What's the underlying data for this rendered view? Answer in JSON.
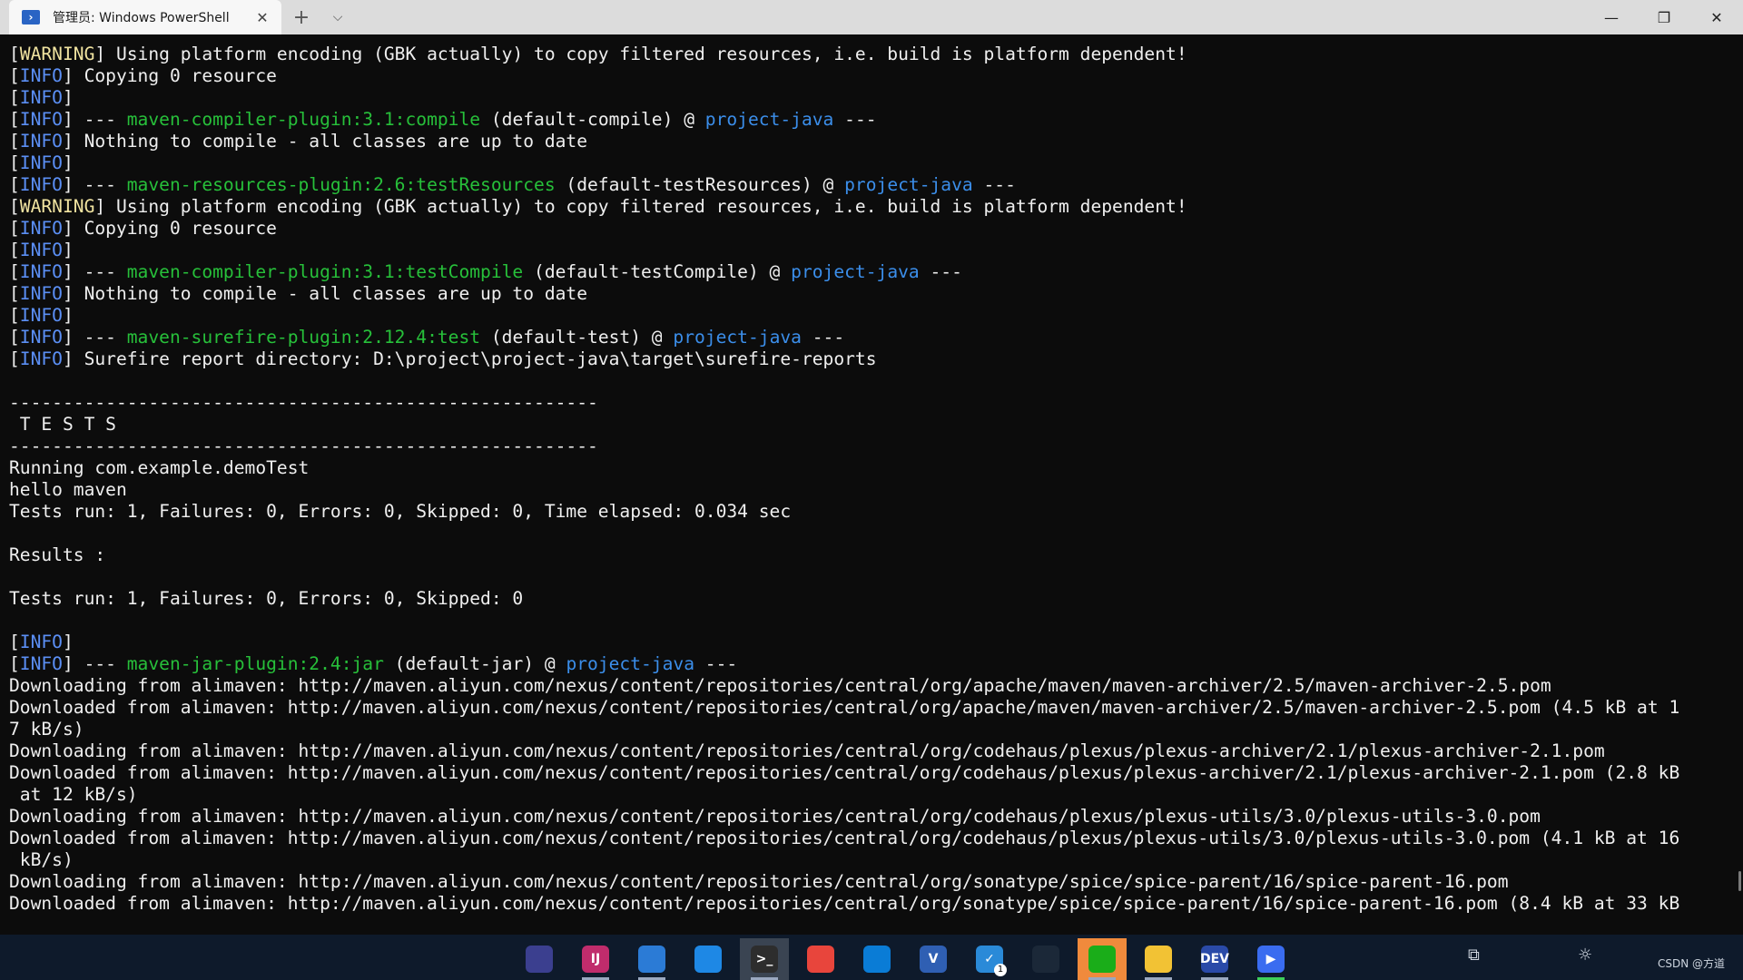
{
  "window": {
    "tab_title": "管理员: Windows PowerShell",
    "tab_icon": "powershell-icon",
    "new_tab": "+",
    "dropdown": "⌵",
    "minimize": "—",
    "restore": "❐",
    "close": "✕"
  },
  "colors": {
    "background": "#0c0c0c",
    "warning": "#f0e3a0",
    "info": "#5b8ff5",
    "plugin": "#27c03a",
    "project": "#3b8eea"
  },
  "terminal": {
    "lines": [
      [
        {
          "t": "[",
          "c": "w"
        },
        {
          "t": "WARNING",
          "c": "y"
        },
        {
          "t": "] Using platform encoding (GBK actually) to copy filtered resources, i.e. build is platform dependent!",
          "c": "w"
        }
      ],
      [
        {
          "t": "[",
          "c": "w"
        },
        {
          "t": "INFO",
          "c": "b"
        },
        {
          "t": "] Copying 0 resource",
          "c": "w"
        }
      ],
      [
        {
          "t": "[",
          "c": "w"
        },
        {
          "t": "INFO",
          "c": "b"
        },
        {
          "t": "]",
          "c": "w"
        }
      ],
      [
        {
          "t": "[",
          "c": "w"
        },
        {
          "t": "INFO",
          "c": "b"
        },
        {
          "t": "] --- ",
          "c": "w"
        },
        {
          "t": "maven-compiler-plugin:3.1:compile",
          "c": "g"
        },
        {
          "t": " (default-compile) @ ",
          "c": "w"
        },
        {
          "t": "project-java",
          "c": "p"
        },
        {
          "t": " ---",
          "c": "w"
        }
      ],
      [
        {
          "t": "[",
          "c": "w"
        },
        {
          "t": "INFO",
          "c": "b"
        },
        {
          "t": "] Nothing to compile - all classes are up to date",
          "c": "w"
        }
      ],
      [
        {
          "t": "[",
          "c": "w"
        },
        {
          "t": "INFO",
          "c": "b"
        },
        {
          "t": "]",
          "c": "w"
        }
      ],
      [
        {
          "t": "[",
          "c": "w"
        },
        {
          "t": "INFO",
          "c": "b"
        },
        {
          "t": "] --- ",
          "c": "w"
        },
        {
          "t": "maven-resources-plugin:2.6:testResources",
          "c": "g"
        },
        {
          "t": " (default-testResources) @ ",
          "c": "w"
        },
        {
          "t": "project-java",
          "c": "p"
        },
        {
          "t": " ---",
          "c": "w"
        }
      ],
      [
        {
          "t": "[",
          "c": "w"
        },
        {
          "t": "WARNING",
          "c": "y"
        },
        {
          "t": "] Using platform encoding (GBK actually) to copy filtered resources, i.e. build is platform dependent!",
          "c": "w"
        }
      ],
      [
        {
          "t": "[",
          "c": "w"
        },
        {
          "t": "INFO",
          "c": "b"
        },
        {
          "t": "] Copying 0 resource",
          "c": "w"
        }
      ],
      [
        {
          "t": "[",
          "c": "w"
        },
        {
          "t": "INFO",
          "c": "b"
        },
        {
          "t": "]",
          "c": "w"
        }
      ],
      [
        {
          "t": "[",
          "c": "w"
        },
        {
          "t": "INFO",
          "c": "b"
        },
        {
          "t": "] --- ",
          "c": "w"
        },
        {
          "t": "maven-compiler-plugin:3.1:testCompile",
          "c": "g"
        },
        {
          "t": " (default-testCompile) @ ",
          "c": "w"
        },
        {
          "t": "project-java",
          "c": "p"
        },
        {
          "t": " ---",
          "c": "w"
        }
      ],
      [
        {
          "t": "[",
          "c": "w"
        },
        {
          "t": "INFO",
          "c": "b"
        },
        {
          "t": "] Nothing to compile - all classes are up to date",
          "c": "w"
        }
      ],
      [
        {
          "t": "[",
          "c": "w"
        },
        {
          "t": "INFO",
          "c": "b"
        },
        {
          "t": "]",
          "c": "w"
        }
      ],
      [
        {
          "t": "[",
          "c": "w"
        },
        {
          "t": "INFO",
          "c": "b"
        },
        {
          "t": "] --- ",
          "c": "w"
        },
        {
          "t": "maven-surefire-plugin:2.12.4:test",
          "c": "g"
        },
        {
          "t": " (default-test) @ ",
          "c": "w"
        },
        {
          "t": "project-java",
          "c": "p"
        },
        {
          "t": " ---",
          "c": "w"
        }
      ],
      [
        {
          "t": "[",
          "c": "w"
        },
        {
          "t": "INFO",
          "c": "b"
        },
        {
          "t": "] Surefire report directory: D:\\project\\project-java\\target\\surefire-reports",
          "c": "w"
        }
      ],
      [
        {
          "t": "",
          "c": "w"
        }
      ],
      [
        {
          "t": "-------------------------------------------------------",
          "c": "w"
        }
      ],
      [
        {
          "t": " T E S T S",
          "c": "w"
        }
      ],
      [
        {
          "t": "-------------------------------------------------------",
          "c": "w"
        }
      ],
      [
        {
          "t": "Running com.example.demoTest",
          "c": "w"
        }
      ],
      [
        {
          "t": "hello maven",
          "c": "w"
        }
      ],
      [
        {
          "t": "Tests run: 1, Failures: 0, Errors: 0, Skipped: 0, Time elapsed: 0.034 sec",
          "c": "w"
        }
      ],
      [
        {
          "t": "",
          "c": "w"
        }
      ],
      [
        {
          "t": "Results :",
          "c": "w"
        }
      ],
      [
        {
          "t": "",
          "c": "w"
        }
      ],
      [
        {
          "t": "Tests run: 1, Failures: 0, Errors: 0, Skipped: 0",
          "c": "w"
        }
      ],
      [
        {
          "t": "",
          "c": "w"
        }
      ],
      [
        {
          "t": "[",
          "c": "w"
        },
        {
          "t": "INFO",
          "c": "b"
        },
        {
          "t": "]",
          "c": "w"
        }
      ],
      [
        {
          "t": "[",
          "c": "w"
        },
        {
          "t": "INFO",
          "c": "b"
        },
        {
          "t": "] --- ",
          "c": "w"
        },
        {
          "t": "maven-jar-plugin:2.4:jar",
          "c": "g"
        },
        {
          "t": " (default-jar) @ ",
          "c": "w"
        },
        {
          "t": "project-java",
          "c": "p"
        },
        {
          "t": " ---",
          "c": "w"
        }
      ],
      [
        {
          "t": "Downloading from alimaven: http://maven.aliyun.com/nexus/content/repositories/central/org/apache/maven/maven-archiver/2.5/maven-archiver-2.5.pom",
          "c": "w"
        }
      ],
      [
        {
          "t": "Downloaded from alimaven: http://maven.aliyun.com/nexus/content/repositories/central/org/apache/maven/maven-archiver/2.5/maven-archiver-2.5.pom (4.5 kB at 1",
          "c": "w"
        }
      ],
      [
        {
          "t": "7 kB/s)",
          "c": "w"
        }
      ],
      [
        {
          "t": "Downloading from alimaven: http://maven.aliyun.com/nexus/content/repositories/central/org/codehaus/plexus/plexus-archiver/2.1/plexus-archiver-2.1.pom",
          "c": "w"
        }
      ],
      [
        {
          "t": "Downloaded from alimaven: http://maven.aliyun.com/nexus/content/repositories/central/org/codehaus/plexus/plexus-archiver/2.1/plexus-archiver-2.1.pom (2.8 kB",
          "c": "w"
        }
      ],
      [
        {
          "t": " at 12 kB/s)",
          "c": "w"
        }
      ],
      [
        {
          "t": "Downloading from alimaven: http://maven.aliyun.com/nexus/content/repositories/central/org/codehaus/plexus/plexus-utils/3.0/plexus-utils-3.0.pom",
          "c": "w"
        }
      ],
      [
        {
          "t": "Downloaded from alimaven: http://maven.aliyun.com/nexus/content/repositories/central/org/codehaus/plexus/plexus-utils/3.0/plexus-utils-3.0.pom (4.1 kB at 16",
          "c": "w"
        }
      ],
      [
        {
          "t": " kB/s)",
          "c": "w"
        }
      ],
      [
        {
          "t": "Downloading from alimaven: http://maven.aliyun.com/nexus/content/repositories/central/org/sonatype/spice/spice-parent/16/spice-parent-16.pom",
          "c": "w"
        }
      ],
      [
        {
          "t": "Downloaded from alimaven: http://maven.aliyun.com/nexus/content/repositories/central/org/sonatype/spice/spice-parent/16/spice-parent-16.pom (8.4 kB at 33 kB",
          "c": "w"
        }
      ]
    ]
  },
  "taskbar": {
    "apps": [
      {
        "name": "eclipse-icon",
        "label": "",
        "color": "#3b3f8f"
      },
      {
        "name": "intellij-icon",
        "label": "IJ",
        "color": "#c02c6c"
      },
      {
        "name": "app-cloud-icon",
        "label": "",
        "color": "#2b7bd6"
      },
      {
        "name": "app-window-icon",
        "label": "",
        "color": "#1e88e5"
      },
      {
        "name": "terminal-icon",
        "label": ">_",
        "color": "#2d2d2d"
      },
      {
        "name": "chrome-icon",
        "label": "",
        "color": "#e8453c"
      },
      {
        "name": "vscode-icon",
        "label": "",
        "color": "#0a7cd6"
      },
      {
        "name": "visio-icon",
        "label": "V",
        "color": "#2f5fb3"
      },
      {
        "name": "todo-icon",
        "label": "✓",
        "color": "#2a8ad8"
      },
      {
        "name": "steam-icon",
        "label": "",
        "color": "#1b2838"
      },
      {
        "name": "wechat-icon",
        "label": "",
        "color": "#1aad19"
      },
      {
        "name": "file-explorer-icon",
        "label": "",
        "color": "#f2c234"
      },
      {
        "name": "devcpp-icon",
        "label": "DEV",
        "color": "#2a4aa8"
      },
      {
        "name": "media-player-icon",
        "label": "▶",
        "color": "#3a6cf0"
      }
    ],
    "todo_badge": "1",
    "watermark": "CSDN @方道"
  }
}
